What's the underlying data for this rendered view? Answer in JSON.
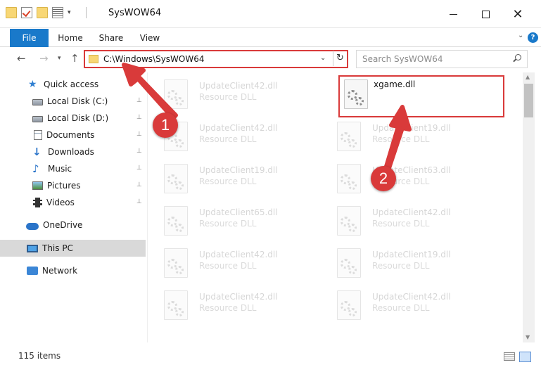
{
  "window": {
    "title": "SysWOW64",
    "minimize_glyph": "",
    "maximize_glyph": "",
    "close_glyph": "✕"
  },
  "ribbon": {
    "tabs": [
      {
        "label": "File"
      },
      {
        "label": "Home"
      },
      {
        "label": "Share"
      },
      {
        "label": "View"
      }
    ],
    "expand_glyph": "⌄",
    "help_glyph": "?"
  },
  "navigation": {
    "back_glyph": "←",
    "forward_glyph": "→",
    "recent_glyph": "▾",
    "up_glyph": "↑",
    "address_path": "C:\\Windows\\SysWOW64",
    "address_dropdown_glyph": "⌄",
    "refresh_glyph": "↻",
    "search_placeholder": "Search SysWOW64"
  },
  "sidebar": {
    "items": [
      {
        "label": "Quick access",
        "icon": "star-icon",
        "pinned": false
      },
      {
        "label": "Local Disk (C:)",
        "icon": "drive-icon",
        "pinned": true
      },
      {
        "label": "Local Disk (D:)",
        "icon": "drive-icon",
        "pinned": true
      },
      {
        "label": "Documents",
        "icon": "documents-icon",
        "pinned": true
      },
      {
        "label": "Downloads",
        "icon": "download-icon",
        "pinned": true
      },
      {
        "label": "Music",
        "icon": "music-icon",
        "pinned": true
      },
      {
        "label": "Pictures",
        "icon": "pictures-icon",
        "pinned": true
      },
      {
        "label": "Videos",
        "icon": "videos-icon",
        "pinned": true
      },
      {
        "label": "OneDrive",
        "icon": "cloud-icon",
        "pinned": false
      },
      {
        "label": "This PC",
        "icon": "computer-icon",
        "pinned": false,
        "selected": true
      },
      {
        "label": "Network",
        "icon": "network-icon",
        "pinned": false
      }
    ],
    "pin_glyph": "📌"
  },
  "files": {
    "highlighted": {
      "name": "xgame.dll"
    },
    "items": [
      {
        "name": "UpdateClient42.dll",
        "type": "Resource DLL"
      },
      {
        "name": "UpdateClient42.dll",
        "type": "Resource DLL"
      },
      {
        "name": "UpdateClient19.dll",
        "type": "Resource DLL"
      },
      {
        "name": "UpdateClient19.dll",
        "type": "Resource DLL"
      },
      {
        "name": "UpdateClient63.dll",
        "type": "Resource DLL"
      },
      {
        "name": "UpdateClient65.dll",
        "type": "Resource DLL"
      },
      {
        "name": "UpdateClient42.dll",
        "type": "Resource DLL"
      },
      {
        "name": "UpdateClient42.dll",
        "type": "Resource DLL"
      },
      {
        "name": "UpdateClient19.dll",
        "type": "Resource DLL"
      },
      {
        "name": "UpdateClient42.dll",
        "type": "Resource DLL"
      },
      {
        "name": "UpdateClient42.dll",
        "type": "Resource DLL"
      }
    ]
  },
  "annotations": {
    "step1": "1",
    "step2": "2",
    "color": "#d93a3a"
  },
  "status": {
    "item_count": "115 items"
  },
  "colors": {
    "accent": "#1979ca",
    "highlight": "#d93a3a"
  }
}
